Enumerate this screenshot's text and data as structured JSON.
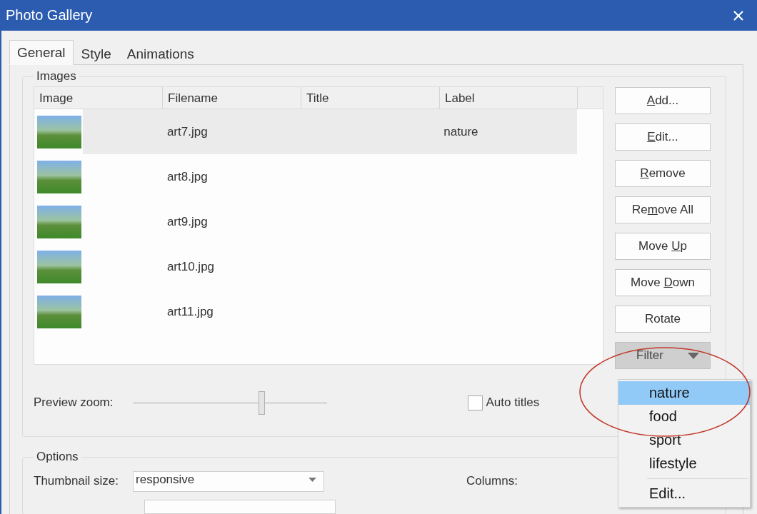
{
  "window": {
    "title": "Photo Gallery"
  },
  "tabs": [
    {
      "label": "General",
      "selected": true
    },
    {
      "label": "Style",
      "selected": false
    },
    {
      "label": "Animations",
      "selected": false
    }
  ],
  "images_group": {
    "legend": "Images",
    "table": {
      "columns": [
        "Image",
        "Filename",
        "Title",
        "Label"
      ],
      "rows": [
        {
          "filename": "art7.jpg",
          "label": "nature",
          "selected": true
        },
        {
          "filename": "art8.jpg",
          "selected": false
        },
        {
          "filename": "art9.jpg",
          "selected": false
        },
        {
          "filename": "art10.jpg",
          "selected": false
        },
        {
          "filename": "art11.jpg",
          "selected": false
        }
      ]
    },
    "buttons": [
      {
        "access_key": "A",
        "after": "dd..."
      },
      {
        "access_key": "E",
        "after": "dit..."
      },
      {
        "access_key": "R",
        "after": "emove"
      },
      {
        "before": "Re",
        "access_key": "m",
        "after": "ove All"
      },
      {
        "before": "Move ",
        "access_key": "U",
        "after": "p"
      },
      {
        "before": "Move ",
        "access_key": "D",
        "after": "own"
      },
      {
        "before": "Rotate"
      }
    ],
    "filter": {
      "label": "Filter",
      "open": true,
      "menu": {
        "items": [
          {
            "label": "nature",
            "selected": true
          },
          {
            "label": "food",
            "selected": false
          },
          {
            "label": "sport",
            "selected": false
          },
          {
            "label": "lifestyle",
            "selected": false
          }
        ],
        "action": "Edit..."
      }
    },
    "preview_zoom": {
      "label": "Preview zoom:",
      "level": 0.66
    },
    "auto_titles": {
      "label": "Auto titles",
      "checked": false
    }
  },
  "options_group": {
    "legend": "Options",
    "thumbnail_size": {
      "label": "Thumbnail size:",
      "value": "responsive"
    },
    "columns": {
      "label": "Columns:"
    }
  }
}
